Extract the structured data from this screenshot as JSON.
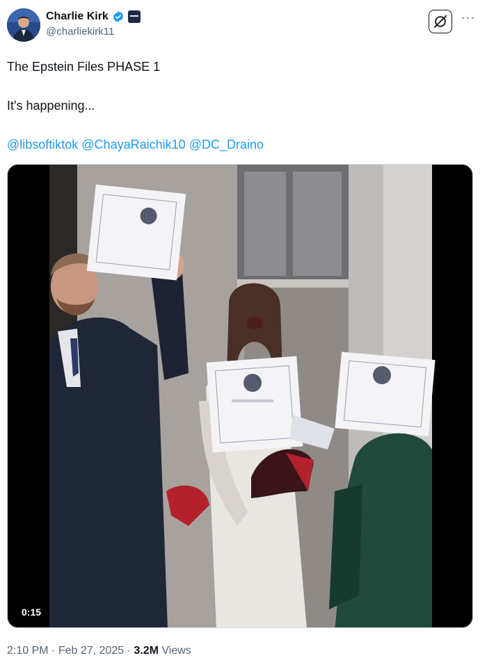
{
  "author": {
    "display_name": "Charlie Kirk",
    "handle": "@charliekirk11",
    "verified_color": "#1d9bf0",
    "avatar_icon": "profile-photo"
  },
  "header": {
    "grok_icon": "grok-icon",
    "more_label": "···"
  },
  "tweet": {
    "line1": "The Epstein Files PHASE 1",
    "line2": "It's happening...",
    "mentions": [
      "@libsoftiktok",
      "@ChayaRaichik10",
      "@DC_Draino"
    ]
  },
  "media": {
    "duration": "0:15",
    "type": "video"
  },
  "meta": {
    "time": "2:10 PM",
    "date": "Feb 27, 2025",
    "separator": "·",
    "views_count": "3.2M",
    "views_label": "Views"
  },
  "colors": {
    "link": "#1d9bf0",
    "secondary_text": "#536471",
    "primary_text": "#0f1419"
  }
}
